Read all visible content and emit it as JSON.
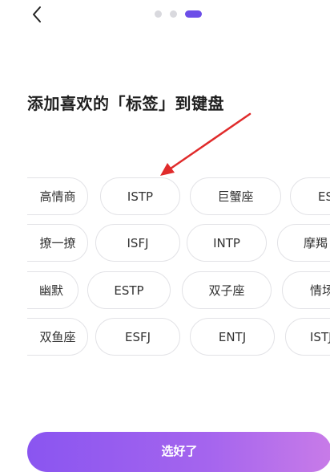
{
  "header": {
    "back_icon": "chevron-left-icon",
    "progress_steps": 3,
    "active_step": 3
  },
  "page": {
    "title": "添加喜欢的「标签」到键盘"
  },
  "tags": {
    "rows": [
      [
        "高情商",
        "ISTP",
        "巨蟹座",
        "ES"
      ],
      [
        "撩一撩",
        "ISFJ",
        "INTP",
        "摩羯"
      ],
      [
        "幽默",
        "ESTP",
        "双子座",
        "情场"
      ],
      [
        "双鱼座",
        "ESFJ",
        "ENTJ",
        "ISTJ"
      ]
    ]
  },
  "footer": {
    "confirm_label": "选好了"
  },
  "colors": {
    "accent": "#6c4ee8",
    "arrow": "#e02b2b",
    "tag_border": "#e2e2e6"
  }
}
